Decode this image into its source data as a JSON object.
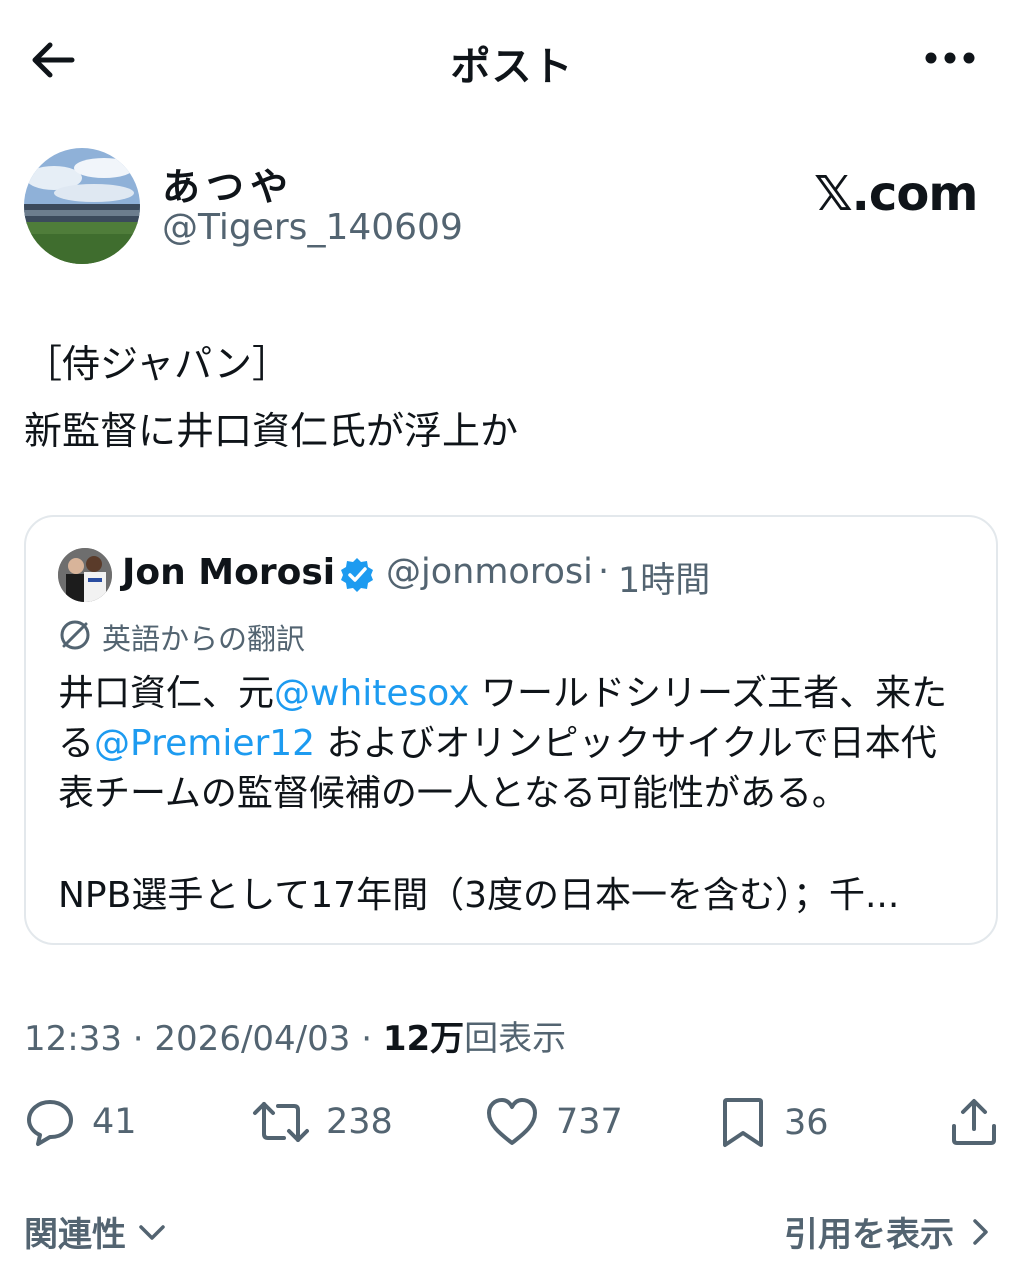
{
  "header": {
    "title": "ポスト",
    "back_icon": "arrow-left-icon",
    "more_icon": "more-horizontal-icon"
  },
  "author": {
    "display_name": "あつや",
    "handle": "@Tigers_140609",
    "watermark": "𝕏.com"
  },
  "post": {
    "lines": [
      "［侍ジャパン］",
      "新監督に井口資仁氏が浮上か"
    ]
  },
  "quote": {
    "name": "Jon Morosi",
    "handle": "@jonmorosi",
    "separator": "·",
    "time": "1時間",
    "translation_label": "英語からの翻訳",
    "line1_a": "井口資仁、元",
    "mention1": "@whitesox",
    "line1_b": " ワールドシリーズ王者、来た",
    "line2_a": "る",
    "mention2": "@Premier12",
    "line2_b": " およびオリンピックサイクルで日本代",
    "line3": "表チームの監督候補の一人となる可能性がある。",
    "line4": "NPB選手として17年間（3度の日本一を含む）；千..."
  },
  "meta": {
    "time": "12:33",
    "sep1": " · ",
    "date": "2026/04/03",
    "sep2": " · ",
    "views_count": "12万",
    "views_label": "回表示"
  },
  "actions": {
    "replies": "41",
    "reposts": "238",
    "likes": "737",
    "bookmarks": "36"
  },
  "footer": {
    "related": "関連性",
    "view_quotes": "引用を表示"
  },
  "colors": {
    "text": "#0f1419",
    "secondary": "#536471",
    "link": "#1d9bf0",
    "border": "#e3e8ec"
  }
}
